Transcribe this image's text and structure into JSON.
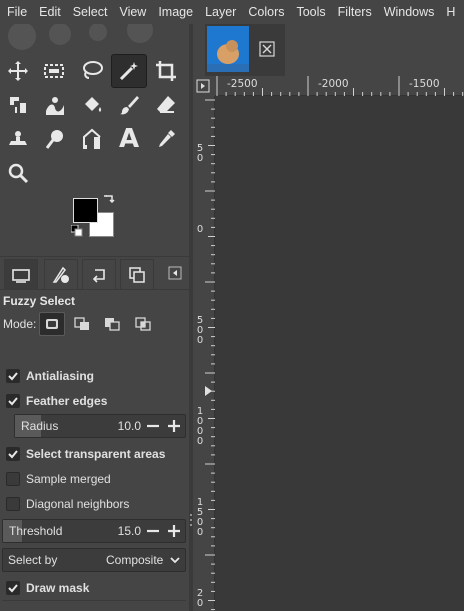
{
  "menubar": {
    "items": [
      "File",
      "Edit",
      "Select",
      "View",
      "Image",
      "Layer",
      "Colors",
      "Tools",
      "Filters",
      "Windows",
      "H"
    ]
  },
  "toolbox": {
    "tools": [
      {
        "name": "move-tool-icon"
      },
      {
        "name": "rect-select-tool-icon"
      },
      {
        "name": "free-select-tool-icon"
      },
      {
        "name": "fuzzy-select-tool-icon",
        "active": true
      },
      {
        "name": "crop-tool-icon"
      },
      {
        "name": "unified-transform-tool-icon"
      },
      {
        "name": "warp-transform-tool-icon"
      },
      {
        "name": "bucket-fill-tool-icon"
      },
      {
        "name": "paintbrush-tool-icon"
      },
      {
        "name": "eraser-tool-icon"
      },
      {
        "name": "clone-tool-icon"
      },
      {
        "name": "smudge-tool-icon"
      },
      {
        "name": "paths-tool-icon"
      },
      {
        "name": "text-tool-icon"
      },
      {
        "name": "color-picker-tool-icon"
      },
      {
        "name": "zoom-tool-icon"
      }
    ],
    "text_tool_glyph": "A",
    "foreground_color": "#000000",
    "background_color": "#ffffff"
  },
  "dock": {
    "tabs": [
      "tool-options-tab",
      "device-status-tab",
      "undo-history-tab",
      "images-tab"
    ]
  },
  "tool_options": {
    "title": "Fuzzy Select",
    "mode_label": "Mode:",
    "antialiasing": {
      "label": "Antialiasing",
      "checked": true
    },
    "feather_edges": {
      "label": "Feather edges",
      "checked": true
    },
    "radius": {
      "label": "Radius",
      "value": "10.0",
      "fraction": 0.2
    },
    "select_transparent": {
      "label": "Select transparent areas",
      "checked": true
    },
    "sample_merged": {
      "label": "Sample merged",
      "checked": false
    },
    "diagonal_neighbors": {
      "label": "Diagonal neighbors",
      "checked": false
    },
    "threshold": {
      "label": "Threshold",
      "value": "15.0",
      "fraction": 0.08
    },
    "select_by": {
      "label": "Select by",
      "value": "Composite"
    },
    "draw_mask": {
      "label": "Draw mask",
      "checked": true
    }
  },
  "image_window": {
    "ruler_h": [
      "-2500",
      "-2000",
      "-1500"
    ],
    "ruler_v": [
      [
        "5",
        "0"
      ],
      [
        "0"
      ],
      [
        "5",
        "0",
        "0"
      ],
      [
        "1",
        "0",
        "0",
        "0"
      ],
      [
        "1",
        "5",
        "0",
        "0"
      ],
      [
        "2",
        "0"
      ]
    ]
  }
}
